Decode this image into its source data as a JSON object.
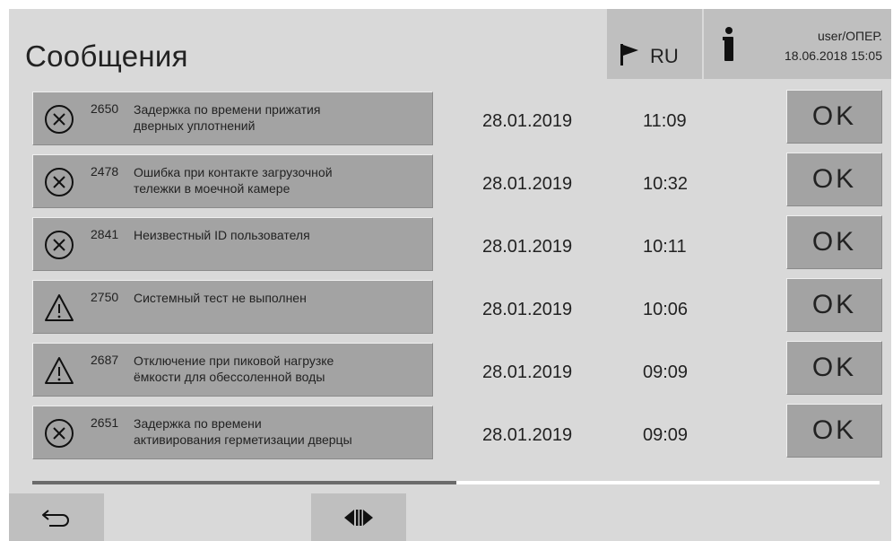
{
  "header": {
    "title": "Сообщения",
    "language": {
      "label": "RU",
      "icon": "flag-icon"
    },
    "user": {
      "name": "user/ОПЕР.",
      "datetime": "18.06.2018 15:05",
      "icon": "user-icon"
    }
  },
  "messages": [
    {
      "icon": "error-circle-x-icon",
      "code": "2650",
      "text_line1": "Задержка по времени прижатия",
      "text_line2": "дверных уплотнений",
      "date": "28.01.2019",
      "time": "11:09",
      "ok_label": "OK"
    },
    {
      "icon": "error-circle-x-icon",
      "code": "2478",
      "text_line1": "Ошибка при контакте загрузочной",
      "text_line2": "тележки в моечной камере",
      "date": "28.01.2019",
      "time": "10:32",
      "ok_label": "OK"
    },
    {
      "icon": "error-circle-x-icon",
      "code": "2841",
      "text_line1": "Неизвестный ID пользователя",
      "text_line2": "",
      "date": "28.01.2019",
      "time": "10:11",
      "ok_label": "OK"
    },
    {
      "icon": "warning-triangle-icon",
      "code": "2750",
      "text_line1": "Системный тест не выполнен",
      "text_line2": "",
      "date": "28.01.2019",
      "time": "10:06",
      "ok_label": "OK"
    },
    {
      "icon": "warning-triangle-icon",
      "code": "2687",
      "text_line1": "Отключение при пиковой нагрузке",
      "text_line2": "ёмкости для обессоленной воды",
      "date": "28.01.2019",
      "time": "09:09",
      "ok_label": "OK"
    },
    {
      "icon": "error-circle-x-icon",
      "code": "2651",
      "text_line1": "Задержка по времени",
      "text_line2": "активирования герметизации дверцы",
      "date": "28.01.2019",
      "time": "09:09",
      "ok_label": "OK"
    }
  ],
  "scrollbar": {
    "position_fraction": 0.5
  },
  "footer": {
    "back_icon": "back-arrow-icon",
    "split_icon": "split-view-icon"
  },
  "colors": {
    "background": "#d9d9d9",
    "button": "#a3a3a3",
    "header_button": "#bfbfbf"
  }
}
